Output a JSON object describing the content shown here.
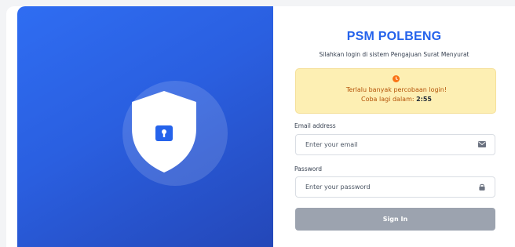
{
  "app": {
    "title": "PSM POLBENG",
    "subtitle": "Silahkan login di sistem Pengajuan Surat Menyurat"
  },
  "alert": {
    "line1": "Terlalu banyak percobaan login!",
    "line2_prefix": "Coba lagi dalam: ",
    "countdown": "2:55",
    "icon": "clock-icon"
  },
  "form": {
    "email_label": "Email address",
    "email_placeholder": "Enter your email",
    "email_icon": "envelope-icon",
    "password_label": "Password",
    "password_placeholder": "Enter your password",
    "password_icon": "lock-icon",
    "submit_label": "Sign In"
  },
  "hero": {
    "icon": "shield-lock-icon"
  },
  "colors": {
    "primary": "#2563eb",
    "hero_start": "#2f6df2",
    "hero_end": "#2447b8",
    "alert_bg": "#fdefb3",
    "alert_text": "#b45309",
    "button_disabled": "#9ca3af"
  }
}
